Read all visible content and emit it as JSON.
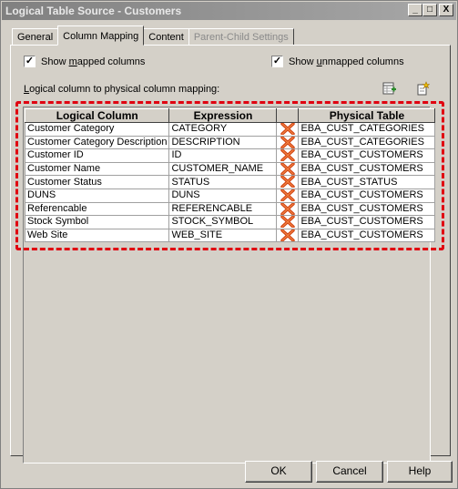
{
  "window": {
    "title": "Logical Table Source - Customers"
  },
  "titlebar_buttons": {
    "minimize": "_",
    "maximize": "□",
    "close": "X"
  },
  "tabs": [
    {
      "label": "General",
      "active": false,
      "disabled": false
    },
    {
      "label": "Column Mapping",
      "active": true,
      "disabled": false
    },
    {
      "label": "Content",
      "active": false,
      "disabled": false
    },
    {
      "label": "Parent-Child Settings",
      "active": false,
      "disabled": true
    }
  ],
  "options": {
    "show_mapped": {
      "pre": "Show ",
      "u": "m",
      "post": "apped columns",
      "checked": true,
      "mark": "✓"
    },
    "show_unmapped": {
      "pre": "Show ",
      "u": "u",
      "post": "nmapped columns",
      "checked": true,
      "mark": "✓"
    }
  },
  "mapping_label": {
    "u": "L",
    "rest": "ogical column to physical column mapping:"
  },
  "toolbar_icons": [
    "table-add-icon",
    "new-item-icon"
  ],
  "grid": {
    "headers": [
      "Logical Column",
      "Expression",
      "",
      "Physical Table"
    ],
    "rows": [
      [
        "Customer Category",
        "CATEGORY",
        "EBA_CUST_CATEGORIES"
      ],
      [
        "Customer Category Description",
        "DESCRIPTION",
        "EBA_CUST_CATEGORIES"
      ],
      [
        "Customer ID",
        "ID",
        "EBA_CUST_CUSTOMERS"
      ],
      [
        "Customer Name",
        "CUSTOMER_NAME",
        "EBA_CUST_CUSTOMERS"
      ],
      [
        "Customer Status",
        "STATUS",
        "EBA_CUST_STATUS"
      ],
      [
        "DUNS",
        "DUNS",
        "EBA_CUST_CUSTOMERS"
      ],
      [
        "Referencable",
        "REFERENCABLE",
        "EBA_CUST_CUSTOMERS"
      ],
      [
        "Stock Symbol",
        "STOCK_SYMBOL",
        "EBA_CUST_CUSTOMERS"
      ],
      [
        "Web Site",
        "WEB_SITE",
        "EBA_CUST_CUSTOMERS"
      ]
    ],
    "delete_icon": "delete-x-icon"
  },
  "buttons": {
    "ok": "OK",
    "cancel": "Cancel",
    "help": "Help"
  },
  "colors": {
    "highlight": "#e00010",
    "delete_icon": "#d04010",
    "window_bg": "#d4d0c8"
  }
}
